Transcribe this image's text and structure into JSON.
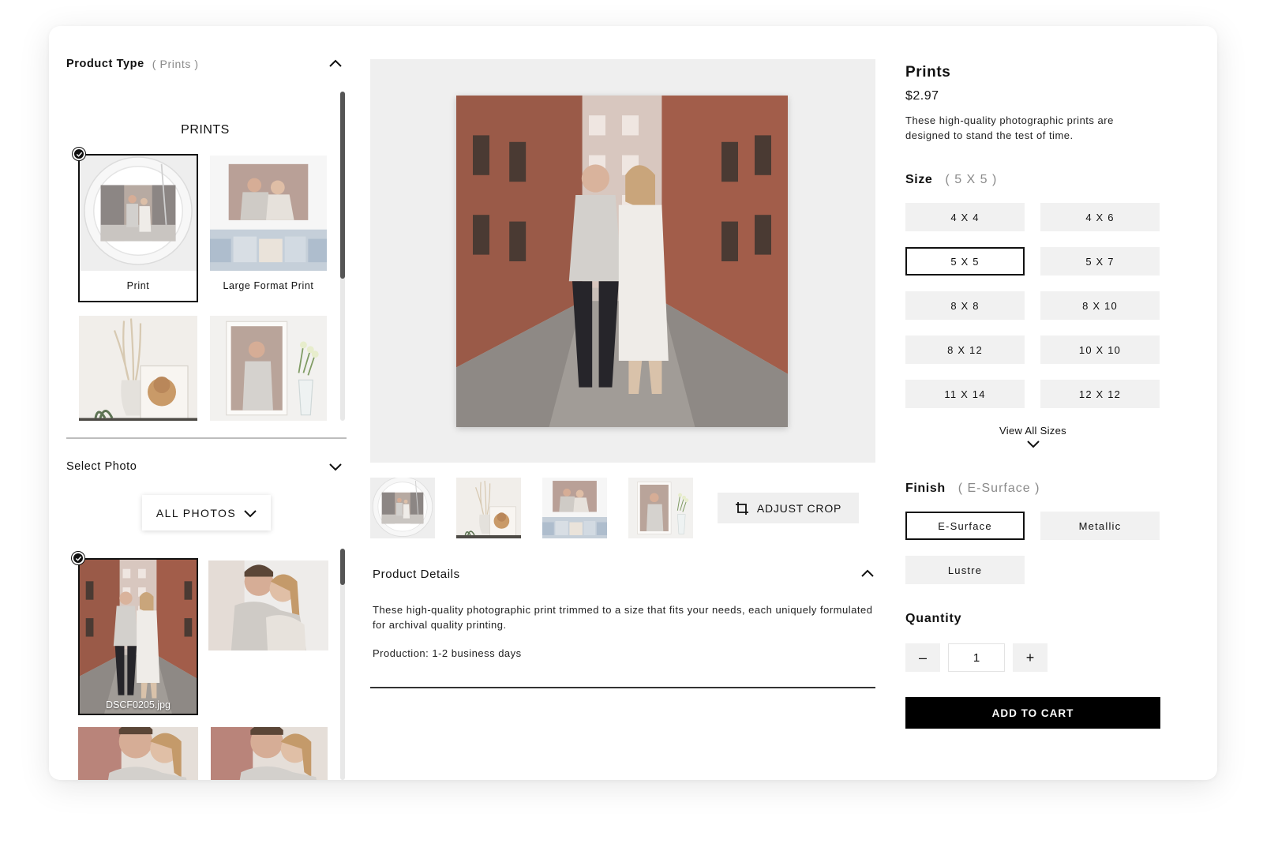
{
  "product_type": {
    "title": "Product Type",
    "selected": "( Prints )"
  },
  "catalog": {
    "heading": "PRINTS",
    "items": [
      {
        "label": "Print",
        "selected": true
      },
      {
        "label": "Large Format Print",
        "selected": false
      },
      {
        "label": "",
        "selected": false
      },
      {
        "label": "",
        "selected": false
      }
    ]
  },
  "select_photo": {
    "title": "Select Photo",
    "filter_label": "ALL PHOTOS",
    "photos": [
      {
        "filename": "DSCF0205.jpg",
        "selected": true
      }
    ]
  },
  "preview": {
    "adjust_crop_label": "ADJUST CROP"
  },
  "product_details": {
    "title": "Product Details",
    "description": "These high-quality photographic print trimmed to a size that fits your needs, each uniquely formulated for archival quality printing.",
    "production": "Production: 1-2 business days"
  },
  "product": {
    "title": "Prints",
    "price": "$2.97",
    "description": "These high-quality photographic prints are designed to stand the test of time."
  },
  "size": {
    "label": "Size",
    "selected_display": "( 5 X 5 )",
    "options": [
      "4 X 4",
      "4 X 6",
      "5 X 5",
      "5 X 7",
      "8 X 8",
      "8 X 10",
      "8 X 12",
      "10 X 10",
      "11 X 14",
      "12 X 12"
    ],
    "selected": "5 X 5",
    "view_all_label": "View All Sizes"
  },
  "finish": {
    "label": "Finish",
    "selected_display": "( E-Surface )",
    "options": [
      "E-Surface",
      "Metallic",
      "Lustre"
    ],
    "selected": "E-Surface"
  },
  "quantity": {
    "label": "Quantity",
    "minus": "–",
    "plus": "+",
    "value": "1"
  },
  "cart": {
    "label": "ADD TO CART"
  },
  "colors": {
    "accent": "#000000",
    "panel_bg": "#efefef",
    "option_bg": "#f1f1f1",
    "muted_text": "#8a8a8a"
  }
}
